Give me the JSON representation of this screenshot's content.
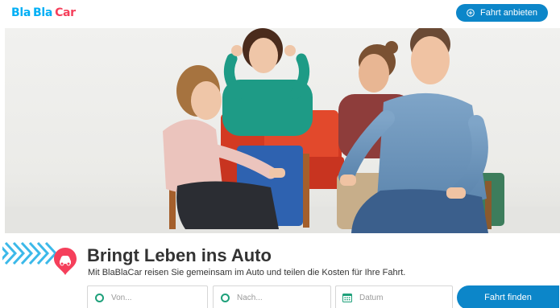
{
  "header": {
    "logo": {
      "part1": "Bla",
      "part2": "Bla",
      "part3": "Car"
    },
    "offer_button": "Fahrt anbieten"
  },
  "hero": {
    "image": "photo of four people smiling while sitting on chairs"
  },
  "main": {
    "title": "Bringt Leben ins Auto",
    "subtitle": "Mit BlaBlaCar reisen Sie gemeinsam im Auto und teilen die Kosten für Ihre Fahrt."
  },
  "search": {
    "from_placeholder": "Von...",
    "to_placeholder": "Nach...",
    "date_placeholder": "Datum",
    "submit": "Fahrt finden"
  },
  "colors": {
    "brand_blue": "#00aff5",
    "brand_red": "#f53f5b",
    "button_blue": "#0c86c9",
    "location_green": "#1ea07a",
    "chevron_blue": "#3cb9e9"
  }
}
